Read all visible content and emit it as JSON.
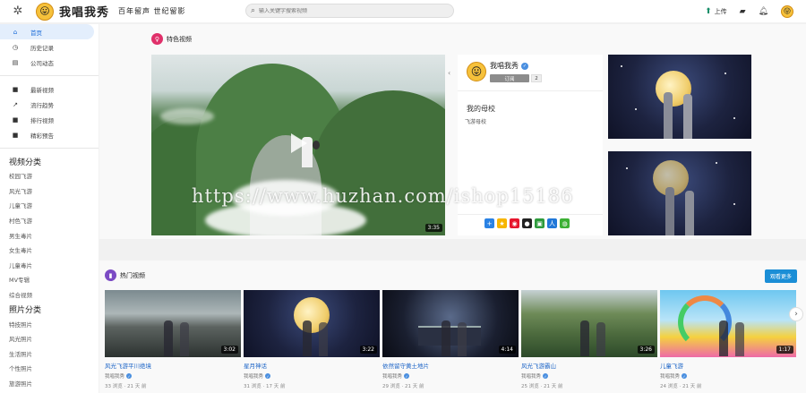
{
  "header": {
    "logo_title": "我唱我秀",
    "slogan": "百年留声  世纪留影",
    "search_placeholder": "输入关键字搜索视频",
    "upload_label": "上传"
  },
  "sidebar": {
    "nav": [
      {
        "label": "首页",
        "icon": "home-icon",
        "glyph": "⌂",
        "active": true
      },
      {
        "label": "历史记录",
        "icon": "history-icon",
        "glyph": "◷"
      },
      {
        "label": "公司动态",
        "icon": "news-icon",
        "glyph": "▤"
      }
    ],
    "nav2": [
      {
        "label": "最新视频",
        "icon": "video-icon",
        "glyph": "■"
      },
      {
        "label": "流行趋势",
        "icon": "trending-icon",
        "glyph": "↗"
      },
      {
        "label": "排行视频",
        "icon": "ranking-icon",
        "glyph": "■"
      },
      {
        "label": "精彩预告",
        "icon": "trailer-icon",
        "glyph": "■"
      }
    ],
    "video_category_title": "视频分类",
    "video_categories": [
      "校园飞游",
      "风光飞游",
      "儿童飞游",
      "村色飞游",
      "男生毒片",
      "女生毒片",
      "儿童毒片",
      "MV专辑",
      "综合视频"
    ],
    "photo_category_title": "照片分类",
    "photo_categories": [
      "特技照片",
      "风光照片",
      "生活照片",
      "个性照片",
      "旅游照片"
    ]
  },
  "featured": {
    "title": "特色视频",
    "duration": "3:35",
    "channel_name": "我唱我秀",
    "subscribe_label": "订阅",
    "subscriber_count": "2",
    "headline": "我的母校",
    "subline": "飞游母校"
  },
  "watermark": "https://www.huzhan.com/ishop15186",
  "hot": {
    "title": "热门视频",
    "more_label": "观看更多",
    "videos": [
      {
        "title": "风光飞游平川绝境",
        "channel": "我唱我秀",
        "stats": "33 浏览 · 21 天 前",
        "duration": "3:02"
      },
      {
        "title": "星月神话",
        "channel": "我唱我秀",
        "stats": "31 浏览 · 17 天 前",
        "duration": "3:22"
      },
      {
        "title": "依然留守黄土地片",
        "channel": "我唱我秀",
        "stats": "29 浏览 · 21 天 前",
        "duration": "4:14"
      },
      {
        "title": "风光飞游霸山",
        "channel": "我唱我秀",
        "stats": "25 浏览 · 21 天 前",
        "duration": "3:26"
      },
      {
        "title": "儿童飞游",
        "channel": "我唱我秀",
        "stats": "24 浏览 · 21 天 前",
        "duration": "1:17"
      }
    ]
  },
  "colors": {
    "accent": "#1a6bd8",
    "link": "#1a63c6",
    "more_button": "#1b8ed6"
  }
}
